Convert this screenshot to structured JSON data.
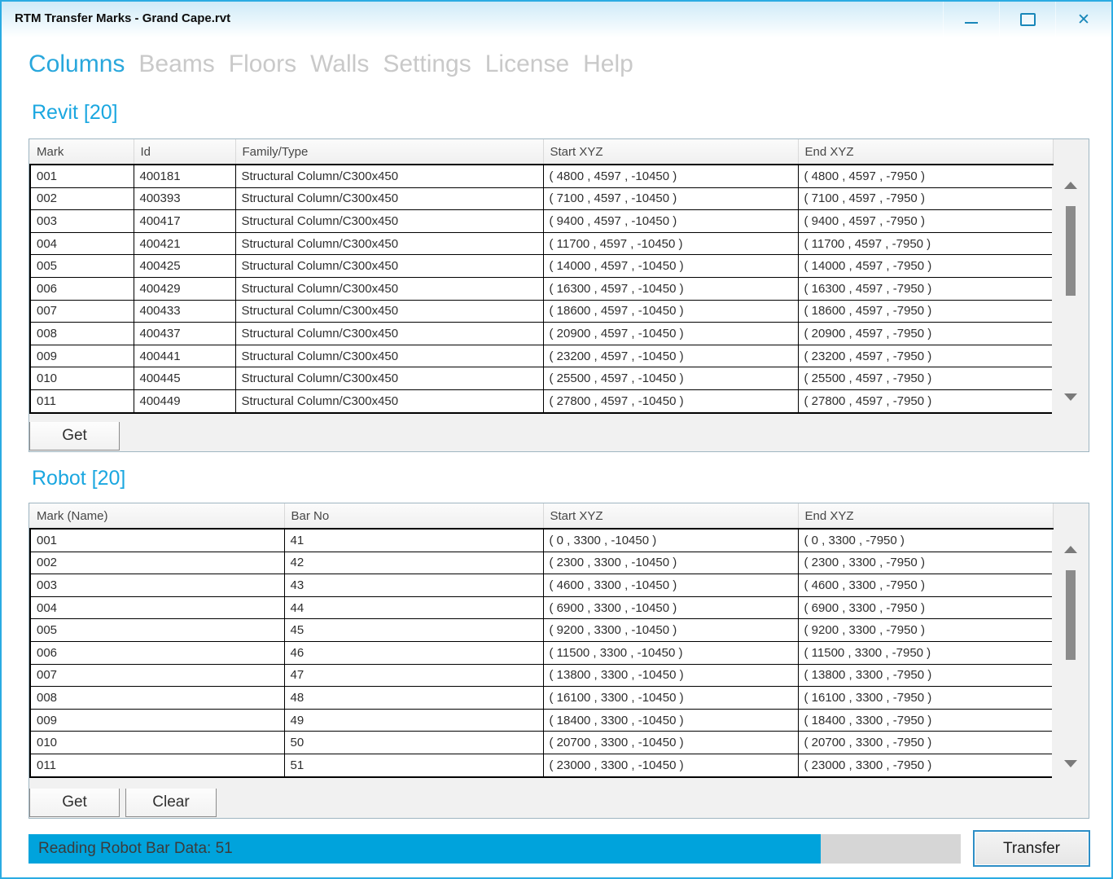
{
  "window": {
    "title": "RTM Transfer Marks - Grand Cape.rvt"
  },
  "menu": {
    "items": [
      "Columns",
      "Beams",
      "Floors",
      "Walls",
      "Settings",
      "License",
      "Help"
    ],
    "active_index": 0
  },
  "revit": {
    "label": "Revit [20]",
    "columns": [
      "Mark",
      "Id",
      "Family/Type",
      "Start XYZ",
      "End XYZ"
    ],
    "rows": [
      [
        "001",
        "400181",
        "Structural Column/C300x450",
        "( 4800 , 4597 , -10450 )",
        "( 4800 , 4597 , -7950 )"
      ],
      [
        "002",
        "400393",
        "Structural Column/C300x450",
        "( 7100 , 4597 , -10450 )",
        "( 7100 , 4597 , -7950 )"
      ],
      [
        "003",
        "400417",
        "Structural Column/C300x450",
        "( 9400 , 4597 , -10450 )",
        "( 9400 , 4597 , -7950 )"
      ],
      [
        "004",
        "400421",
        "Structural Column/C300x450",
        "( 11700 , 4597 , -10450 )",
        "( 11700 , 4597 , -7950 )"
      ],
      [
        "005",
        "400425",
        "Structural Column/C300x450",
        "( 14000 , 4597 , -10450 )",
        "( 14000 , 4597 , -7950 )"
      ],
      [
        "006",
        "400429",
        "Structural Column/C300x450",
        "( 16300 , 4597 , -10450 )",
        "( 16300 , 4597 , -7950 )"
      ],
      [
        "007",
        "400433",
        "Structural Column/C300x450",
        "( 18600 , 4597 , -10450 )",
        "( 18600 , 4597 , -7950 )"
      ],
      [
        "008",
        "400437",
        "Structural Column/C300x450",
        "( 20900 , 4597 , -10450 )",
        "( 20900 , 4597 , -7950 )"
      ],
      [
        "009",
        "400441",
        "Structural Column/C300x450",
        "( 23200 , 4597 , -10450 )",
        "( 23200 , 4597 , -7950 )"
      ],
      [
        "010",
        "400445",
        "Structural Column/C300x450",
        "( 25500 , 4597 , -10450 )",
        "( 25500 , 4597 , -7950 )"
      ],
      [
        "011",
        "400449",
        "Structural Column/C300x450",
        "( 27800 , 4597 , -10450 )",
        "( 27800 , 4597 , -7950 )"
      ]
    ],
    "get_label": "Get"
  },
  "robot": {
    "label": "Robot [20]",
    "columns": [
      "Mark (Name)",
      "Bar No",
      "Start XYZ",
      "End XYZ"
    ],
    "rows": [
      [
        "001",
        "41",
        "( 0 , 3300 , -10450 )",
        "( 0 , 3300 , -7950 )"
      ],
      [
        "002",
        "42",
        "( 2300 , 3300 , -10450 )",
        "( 2300 , 3300 , -7950 )"
      ],
      [
        "003",
        "43",
        "( 4600 , 3300 , -10450 )",
        "( 4600 , 3300 , -7950 )"
      ],
      [
        "004",
        "44",
        "( 6900 , 3300 , -10450 )",
        "( 6900 , 3300 , -7950 )"
      ],
      [
        "005",
        "45",
        "( 9200 , 3300 , -10450 )",
        "( 9200 , 3300 , -7950 )"
      ],
      [
        "006",
        "46",
        "( 11500 , 3300 , -10450 )",
        "( 11500 , 3300 , -7950 )"
      ],
      [
        "007",
        "47",
        "( 13800 , 3300 , -10450 )",
        "( 13800 , 3300 , -7950 )"
      ],
      [
        "008",
        "48",
        "( 16100 , 3300 , -10450 )",
        "( 16100 , 3300 , -7950 )"
      ],
      [
        "009",
        "49",
        "( 18400 , 3300 , -10450 )",
        "( 18400 , 3300 , -7950 )"
      ],
      [
        "010",
        "50",
        "( 20700 , 3300 , -10450 )",
        "( 20700 , 3300 , -7950 )"
      ],
      [
        "011",
        "51",
        "( 23000 , 3300 , -10450 )",
        "( 23000 , 3300 , -7950 )"
      ]
    ],
    "get_label": "Get",
    "clear_label": "Clear"
  },
  "status": {
    "text": "Reading Robot Bar Data: 51",
    "progress_percent": 85
  },
  "actions": {
    "transfer_label": "Transfer"
  },
  "colors": {
    "accent": "#29A7DC",
    "inactive_menu": "#C9C9C9",
    "window_border": "#2AABE2",
    "progress_fill": "#00A3DC",
    "progress_track": "#D6D6D6",
    "transfer_border": "#2D8EC6",
    "row_border": "#000000"
  }
}
